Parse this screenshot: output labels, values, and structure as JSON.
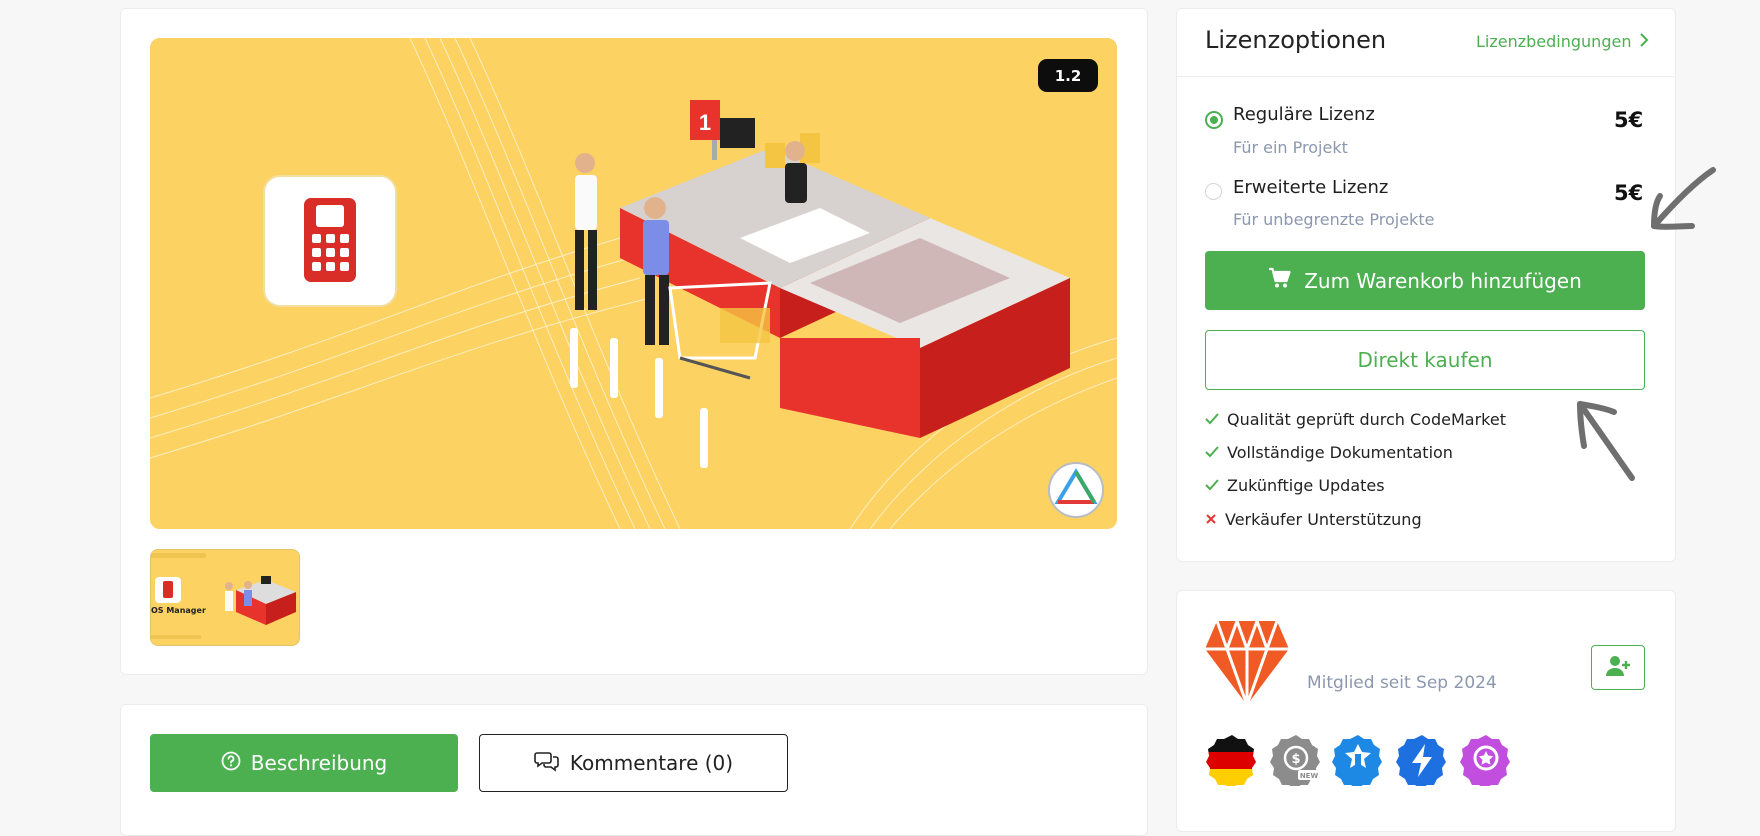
{
  "gallery": {
    "version_badge": "1.2",
    "thumbnail_caption": "OS Manager"
  },
  "license": {
    "title": "Lizenzoptionen",
    "terms_link": "Lizenzbedingungen",
    "options": [
      {
        "name": "Reguläre Lizenz",
        "sub": "Für ein Projekt",
        "price": "5€",
        "selected": true
      },
      {
        "name": "Erweiterte Lizenz",
        "sub": "Für unbegrenzte Projekte",
        "price": "5€",
        "selected": false
      }
    ],
    "add_to_cart": "Zum Warenkorb hinzufügen",
    "buy_now": "Direkt kaufen",
    "features": [
      {
        "text": "Qualität geprüft durch CodeMarket",
        "status": "check"
      },
      {
        "text": "Vollständige Dokumentation",
        "status": "check"
      },
      {
        "text": "Zukünftige Updates",
        "status": "check"
      },
      {
        "text": "Verkäufer Unterstützung",
        "status": "cross"
      }
    ]
  },
  "seller": {
    "member_since": "Mitglied seit Sep 2024",
    "badges": [
      "germany-flag-badge",
      "new-seller-badge",
      "rank-badge",
      "flash-badge",
      "award-badge"
    ]
  },
  "tabs": {
    "description": "Beschreibung",
    "comments": "Kommentare (0)"
  },
  "colors": {
    "accent": "#4caf50",
    "image_bg": "#fcd263",
    "register_red": "#e8322c",
    "muted_text": "#8c97ae"
  }
}
